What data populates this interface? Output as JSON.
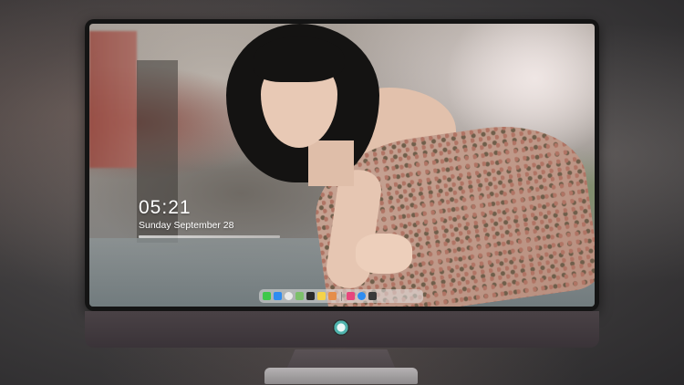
{
  "lock_screen": {
    "time": "05:21",
    "date": "Sunday September  28"
  },
  "dock": {
    "apps": [
      {
        "name": "messages-icon",
        "color": "#3ec84a"
      },
      {
        "name": "mail-icon",
        "color": "#2f8cf0"
      },
      {
        "name": "safari-icon",
        "color": "#e9e9e9"
      },
      {
        "name": "maps-icon",
        "color": "#7cc06a"
      },
      {
        "name": "clapper-icon",
        "color": "#2a2a2a"
      },
      {
        "name": "notes-icon",
        "color": "#f5d34a"
      },
      {
        "name": "photos-icon",
        "color": "#e58d4a"
      },
      {
        "name": "music-icon",
        "color": "#e8467c"
      },
      {
        "name": "app-store-icon",
        "color": "#2f8cf0"
      },
      {
        "name": "camera-icon",
        "color": "#3a3a3a"
      }
    ]
  },
  "colors": {
    "bezel": "#141414",
    "chin": "#4a4246",
    "accent": "#4fb3ad"
  }
}
